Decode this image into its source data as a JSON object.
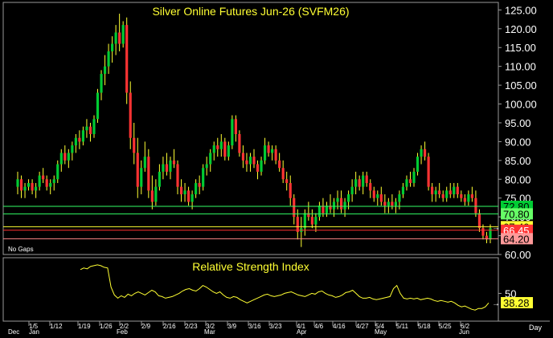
{
  "colors": {
    "background": "#000000",
    "frame": "#9a9a9a",
    "up_candle": "#00cc33",
    "down_candle": "#ff3333",
    "wick": "#ffff33",
    "title": "#ffff33",
    "rsi_line": "#ffff33",
    "axis_text": "#ffffff",
    "grid": "#333333"
  },
  "chart_data": [
    {
      "type": "candlestick",
      "title": "Silver Online Futures Jun-26 (SVFM26)",
      "note": "No Gaps",
      "ylim": [
        60,
        127
      ],
      "y_ticks": [
        "60.00",
        "65.00",
        "70.00",
        "75.00",
        "80.00",
        "85.00",
        "90.00",
        "95.00",
        "100.00",
        "105.00",
        "110.00",
        "115.00",
        "120.00",
        "125.00"
      ],
      "x_ticks": [
        "1/5",
        "1/12",
        "1/19",
        "1/26",
        "2/2",
        "2/9",
        "2/16",
        "2/23",
        "3/2",
        "3/9",
        "3/16",
        "3/23",
        "4/1",
        "4/6",
        "4/16",
        "4/27",
        "5/4",
        "5/11",
        "5/18",
        "5/25",
        "6/2"
      ],
      "months": [
        "Dec",
        "Jan",
        "Feb",
        "Mar",
        "Apr",
        "May",
        "Jun"
      ],
      "x_axis_label": "Day",
      "horizontal_lines": [
        {
          "value": 72.8,
          "label": "72.80",
          "color": "#33ff66",
          "label_bg": "#00cc33",
          "label_fg": "#000000"
        },
        {
          "value": 70.8,
          "label": "70.80",
          "color": "#33ff66",
          "label_bg": "#66ff66",
          "label_fg": "#000000"
        },
        {
          "value": 67.4,
          "label": "67.40",
          "color": "#ffff33",
          "label_bg": "#ffff33",
          "label_fg": "#000000"
        },
        {
          "value": 66.45,
          "label": "66.45",
          "color": "#ff3333",
          "label_bg": "#ff3333",
          "label_fg": "#ffffff"
        },
        {
          "value": 64.2,
          "label": "64.20",
          "color": "#ff8888",
          "label_bg": "#ff9999",
          "label_fg": "#000000"
        }
      ],
      "candles": [
        [
          78,
          82,
          76,
          80
        ],
        [
          80,
          81,
          75,
          77
        ],
        [
          77,
          79,
          75,
          78
        ],
        [
          78,
          80,
          77,
          79
        ],
        [
          79,
          80,
          76,
          77
        ],
        [
          77,
          79,
          75,
          78
        ],
        [
          78,
          82,
          77,
          81
        ],
        [
          81,
          83,
          79,
          80
        ],
        [
          80,
          81,
          77,
          78
        ],
        [
          78,
          80,
          76,
          79
        ],
        [
          79,
          81,
          77,
          80
        ],
        [
          80,
          85,
          79,
          84
        ],
        [
          84,
          88,
          82,
          87
        ],
        [
          87,
          89,
          84,
          85
        ],
        [
          85,
          88,
          83,
          87
        ],
        [
          87,
          90,
          85,
          89
        ],
        [
          89,
          92,
          87,
          91
        ],
        [
          91,
          93,
          88,
          90
        ],
        [
          90,
          94,
          89,
          93
        ],
        [
          93,
          96,
          91,
          94
        ],
        [
          94,
          95,
          90,
          92
        ],
        [
          92,
          97,
          91,
          96
        ],
        [
          96,
          104,
          95,
          103
        ],
        [
          103,
          109,
          101,
          108
        ],
        [
          108,
          113,
          105,
          110
        ],
        [
          110,
          116,
          108,
          114
        ],
        [
          114,
          118,
          111,
          116
        ],
        [
          116,
          121,
          113,
          119
        ],
        [
          119,
          124,
          114,
          116
        ],
        [
          116,
          122,
          115,
          121
        ],
        [
          121,
          123,
          100,
          103
        ],
        [
          103,
          106,
          88,
          91
        ],
        [
          91,
          95,
          84,
          87
        ],
        [
          87,
          91,
          75,
          78
        ],
        [
          78,
          85,
          76,
          83
        ],
        [
          83,
          90,
          82,
          86
        ],
        [
          86,
          88,
          75,
          77
        ],
        [
          77,
          81,
          72,
          74
        ],
        [
          74,
          80,
          73,
          78
        ],
        [
          78,
          84,
          77,
          82
        ],
        [
          82,
          86,
          80,
          84
        ],
        [
          84,
          87,
          81,
          82
        ],
        [
          82,
          86,
          80,
          85
        ],
        [
          85,
          88,
          83,
          84
        ],
        [
          84,
          85,
          76,
          78
        ],
        [
          78,
          80,
          74,
          76
        ],
        [
          76,
          79,
          74,
          77
        ],
        [
          77,
          78,
          73,
          74
        ],
        [
          74,
          77,
          72,
          76
        ],
        [
          76,
          80,
          75,
          79
        ],
        [
          79,
          81,
          76,
          78
        ],
        [
          78,
          84,
          77,
          83
        ],
        [
          83,
          86,
          81,
          84
        ],
        [
          84,
          88,
          82,
          87
        ],
        [
          87,
          90,
          85,
          89
        ],
        [
          89,
          91,
          86,
          88
        ],
        [
          88,
          92,
          86,
          90
        ],
        [
          90,
          91,
          85,
          86
        ],
        [
          86,
          90,
          85,
          89
        ],
        [
          89,
          97,
          88,
          96
        ],
        [
          96,
          97,
          90,
          92
        ],
        [
          92,
          93,
          86,
          87
        ],
        [
          87,
          89,
          83,
          85
        ],
        [
          85,
          87,
          82,
          84
        ],
        [
          84,
          87,
          82,
          86
        ],
        [
          86,
          88,
          83,
          84
        ],
        [
          84,
          85,
          80,
          82
        ],
        [
          82,
          86,
          81,
          85
        ],
        [
          85,
          91,
          84,
          89
        ],
        [
          89,
          90,
          86,
          87
        ],
        [
          87,
          89,
          85,
          88
        ],
        [
          88,
          89,
          84,
          85
        ],
        [
          85,
          87,
          82,
          83
        ],
        [
          83,
          85,
          79,
          80
        ],
        [
          80,
          82,
          77,
          79
        ],
        [
          79,
          81,
          73,
          75
        ],
        [
          75,
          76,
          68,
          70
        ],
        [
          70,
          72,
          64,
          66
        ],
        [
          66,
          70,
          62,
          67
        ],
        [
          67,
          72,
          65,
          71
        ],
        [
          71,
          74,
          69,
          70
        ],
        [
          70,
          72,
          67,
          68
        ],
        [
          68,
          71,
          66,
          70
        ],
        [
          70,
          74,
          69,
          73
        ],
        [
          73,
          75,
          70,
          71
        ],
        [
          71,
          74,
          70,
          73
        ],
        [
          73,
          76,
          71,
          72
        ],
        [
          72,
          75,
          70,
          74
        ],
        [
          74,
          77,
          72,
          75
        ],
        [
          75,
          77,
          71,
          72
        ],
        [
          72,
          75,
          70,
          74
        ],
        [
          74,
          77,
          72,
          76
        ],
        [
          76,
          80,
          74,
          78
        ],
        [
          78,
          82,
          76,
          80
        ],
        [
          80,
          81,
          77,
          78
        ],
        [
          78,
          82,
          76,
          81
        ],
        [
          81,
          82,
          78,
          79
        ],
        [
          79,
          80,
          75,
          77
        ],
        [
          77,
          78,
          74,
          75
        ],
        [
          75,
          77,
          73,
          76
        ],
        [
          76,
          78,
          73,
          74
        ],
        [
          74,
          76,
          71,
          73
        ],
        [
          73,
          75,
          71,
          74
        ],
        [
          74,
          76,
          72,
          73
        ],
        [
          73,
          75,
          71,
          74
        ],
        [
          74,
          77,
          72,
          76
        ],
        [
          76,
          79,
          75,
          78
        ],
        [
          78,
          81,
          77,
          80
        ],
        [
          80,
          82,
          78,
          79
        ],
        [
          79,
          83,
          78,
          82
        ],
        [
          82,
          87,
          81,
          86
        ],
        [
          86,
          89,
          84,
          88
        ],
        [
          88,
          90,
          85,
          86
        ],
        [
          86,
          87,
          77,
          78
        ],
        [
          78,
          79,
          74,
          76
        ],
        [
          76,
          78,
          74,
          77
        ],
        [
          77,
          79,
          75,
          76
        ],
        [
          76,
          77,
          74,
          75
        ],
        [
          75,
          78,
          74,
          77
        ],
        [
          77,
          79,
          75,
          76
        ],
        [
          76,
          79,
          75,
          78
        ],
        [
          78,
          79,
          75,
          76
        ],
        [
          76,
          77,
          74,
          75
        ],
        [
          75,
          76,
          73,
          74
        ],
        [
          74,
          77,
          73,
          76
        ],
        [
          76,
          78,
          74,
          75
        ],
        [
          75,
          77,
          70,
          71
        ],
        [
          71,
          72,
          66,
          67
        ],
        [
          67,
          68,
          64,
          65
        ],
        [
          65,
          66,
          63,
          64
        ],
        [
          64,
          68,
          63,
          67
        ]
      ]
    },
    {
      "type": "line",
      "title": "Relative Strength Index",
      "ylim": [
        15,
        95
      ],
      "y_ticks": [
        "50"
      ],
      "last_value_label": "38.28",
      "values": [
        80,
        82,
        81,
        84,
        85,
        86,
        85,
        83,
        82,
        58,
        48,
        44,
        47,
        45,
        49,
        47,
        50,
        52,
        50,
        48,
        51,
        54,
        52,
        47,
        46,
        44,
        45,
        46,
        48,
        50,
        53,
        55,
        56,
        54,
        53,
        56,
        60,
        58,
        55,
        52,
        50,
        52,
        48,
        45,
        44,
        46,
        45,
        42,
        40,
        38,
        40,
        42,
        44,
        46,
        48,
        49,
        47,
        46,
        47,
        48,
        50,
        51,
        52,
        50,
        48,
        47,
        46,
        48,
        50,
        49,
        52,
        53,
        50,
        48,
        47,
        45,
        46,
        48,
        51,
        52,
        54,
        50,
        46,
        44,
        44,
        45,
        43,
        42,
        43,
        44,
        45,
        46,
        56,
        60,
        50,
        44,
        43,
        44,
        43,
        44,
        42,
        43,
        44,
        43,
        41,
        40,
        41,
        40,
        39,
        40,
        38,
        35,
        33,
        34,
        32,
        30,
        29,
        31,
        31,
        33,
        38
      ]
    }
  ]
}
